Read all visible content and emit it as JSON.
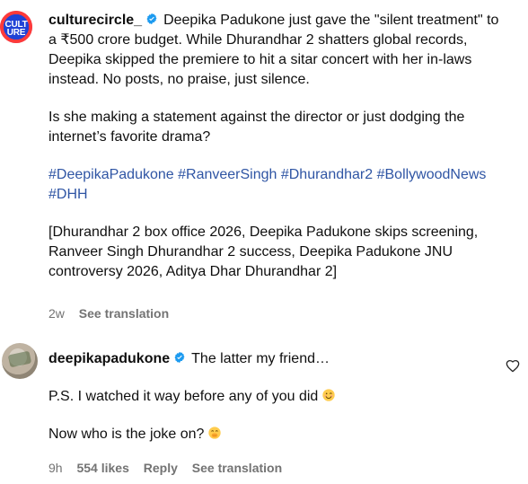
{
  "colors": {
    "text": "#0f0f0f",
    "secondary": "#737373",
    "hashtag": "#2f55a4",
    "verified": "#1d9bf0"
  },
  "icons": {
    "verified": "verified-badge-icon",
    "heart": "heart-outline-icon",
    "emoji_one": "smiling-face-icon",
    "emoji_two": "face-with-hand-over-mouth-icon"
  },
  "post": {
    "username": "culturecircle_",
    "avatar_label": "CULT URE",
    "caption": "Deepika Padukone just gave the \"silent treatment\" to a ₹500 crore budget. While Dhurandhar 2 shatters global records, Deepika skipped the premiere to hit a sitar concert with her in-laws instead. No posts, no praise, just silence.",
    "question": "Is she making a statement against the director or just dodging the internet’s favorite drama?",
    "hashtags": "#DeepikaPadukone #RanveerSingh #Dhurandhar2 #BollywoodNews #DHH",
    "keywords": "[Dhurandhar 2 box office 2026, Deepika Padukone skips screening, Ranveer Singh Dhurandhar 2 success, Deepika Padukone JNU controversy 2026, Aditya Dhar Dhurandhar 2]",
    "time": "2w",
    "translate": "See translation"
  },
  "reply": {
    "username": "deepikapadukone",
    "line1": "The latter my friend…",
    "line2": "P.S. I watched it way before any of you did",
    "line3": "Now who is the joke on?",
    "time": "9h",
    "likes": "554 likes",
    "reply_label": "Reply",
    "translate": "See translation"
  }
}
